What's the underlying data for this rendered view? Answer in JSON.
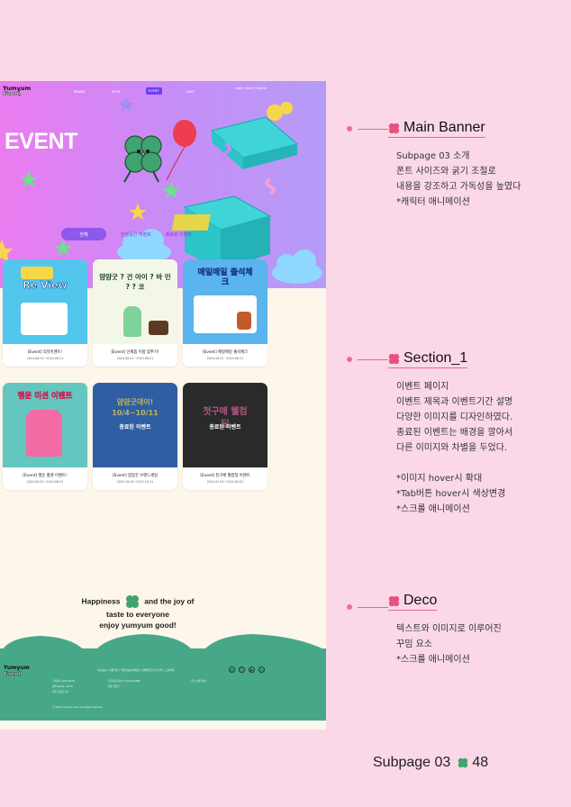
{
  "nav": {
    "logo_top": "Yumyum",
    "logo_bottom": "Good",
    "items": [
      "BRAND",
      "SHOP",
      "EVENT",
      "HELP"
    ],
    "right": "Login | Join | English"
  },
  "hero": {
    "title": "EVENT"
  },
  "tabs": [
    "전체",
    "진행중인 이벤트",
    "종료된 이벤트"
  ],
  "cards": [
    {
      "title": "[Event] 리뷰이벤트!",
      "date": "2024.08.31~2024.08.21",
      "thumb_text": "Re View",
      "bg": "#52c6ec",
      "ended": ""
    },
    {
      "title": "[Event] 신제품 이름 맞추기!",
      "date": "2024.08.01~2024.08.21",
      "thumb_text": "얌얌굿 ? 건 아이 ? 바 민 ? ? 코",
      "bg": "#f3f7e8",
      "ended": ""
    },
    {
      "title": "[Event] 매일매일 출석체크",
      "date": "2024.08.01~2024.08.21",
      "thumb_text": "매일매일 출석체크",
      "bg": "#5ab4ee",
      "ended": ""
    },
    {
      "title": "[Event] 행운 룰렛 이벤트!",
      "date": "2024.08.01~2024.08.21",
      "thumb_text": "행운 미션 이벤트",
      "bg": "#63c6bf",
      "ended": ""
    },
    {
      "title": "[Event] 얌얌굿 브랜드세일",
      "date": "2023.10.04~2023.10.11",
      "thumb_text": "얌얌굿데이! 10/4~10/11",
      "bg": "#2f5fa2",
      "ended": "종료된 이벤트"
    },
    {
      "title": "[Event] 친구배 월컴딜 이벤트",
      "date": "2024.01.01~2024.02.01",
      "thumb_text": "첫구매 웰컴딜",
      "bg": "#2a2a2a",
      "ended": "종료된 이벤트"
    }
  ],
  "slogan": {
    "line1a": "Happiness",
    "line1b": "and the joy of",
    "line2": "taste to everyone",
    "line3": "enjoy yumyum good!"
  },
  "footer": {
    "logo_top": "Yumyum",
    "logo_bottom": "Good",
    "links": "회사정보 | 이용약관 | 개인정보처리방침 | 이메일무단수집거부 | 고객센터",
    "copyright": "© 2024 Yumyum Good. All rights reserved.",
    "info1": "고객센터  1234-5678",
    "info2": "평일 09:00~18:00",
    "info3": "주말·공휴일 휴무",
    "info4": "사업자등록번호  123-45-67890",
    "info5": "대표  얌얌굿",
    "info6": "주소  서울특별시"
  },
  "sections": [
    {
      "title": "Main Banner",
      "desc": "Subpage 03 소개\n폰트 사이즈와 굵기 조절로\n내용을 강조하고 가독성을 높였다\n*캐릭터 애니메이션"
    },
    {
      "title": "Section_1",
      "desc": "이벤트 페이지\n이벤트 제목과 이벤트기간 설명\n다양한 이미지를 디자인하였다.\n종료된 이벤트는 배경을 깔아서\n다른 이미지와 차별을 두었다.\n\n*이미지 hover시 확대\n*Tab버튼 hover시 색상변경\n*스크롤 애니메이션"
    },
    {
      "title": "Deco",
      "desc": "텍스트와 이미지로 이루어진\n꾸밈 요소\n*스크롤 애니메이션"
    }
  ],
  "page_footer": {
    "label": "Subpage 03",
    "number": "48"
  },
  "colors": {
    "pink_bg": "#fbd8e8",
    "accent_pink": "#e8527e",
    "footer_green": "#47a889",
    "tab_purple": "#8e58ea"
  }
}
